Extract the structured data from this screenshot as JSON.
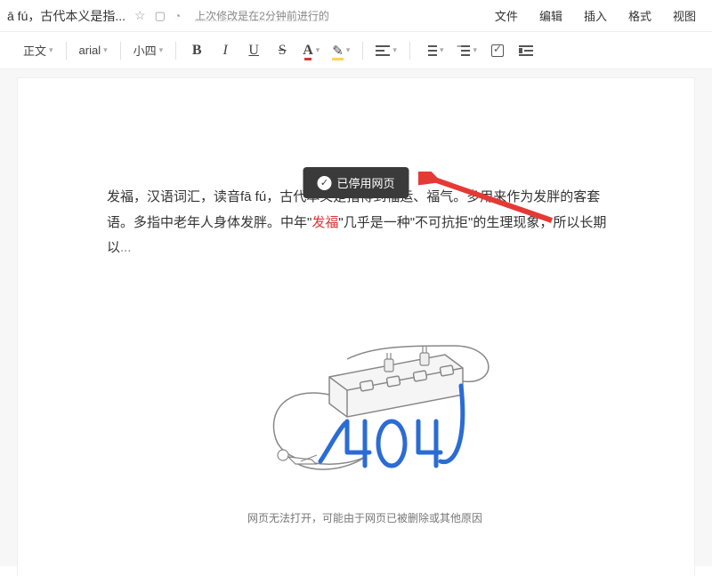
{
  "header": {
    "title": "ā fú，古代本义是指...",
    "last_modified": "上次修改是在2分钟前进行的"
  },
  "menubar": {
    "file": "文件",
    "edit": "编辑",
    "insert": "插入",
    "format": "格式",
    "view": "视图"
  },
  "toolbar": {
    "paragraph_style": "正文",
    "font_family": "arial",
    "font_size": "小四"
  },
  "toast": {
    "message": "已停用网页"
  },
  "document": {
    "para1_a": "发福，汉语词汇，读音fā fú，古代本义是指得到福运、福气。多用来作为发胖的客套语。多指中老年人身体发胖。中年",
    "para1_quote_open": "\"",
    "para1_highlight": "发福",
    "para1_quote_close": "\"",
    "para1_b": "几乎是一种",
    "para1_quote2": "\"不可抗拒\"",
    "para1_c": "的生理现象，所以长期以",
    "para1_ellipsis": "..."
  },
  "error": {
    "code": "404",
    "message": "网页无法打开，可能由于网页已被删除或其他原因"
  }
}
